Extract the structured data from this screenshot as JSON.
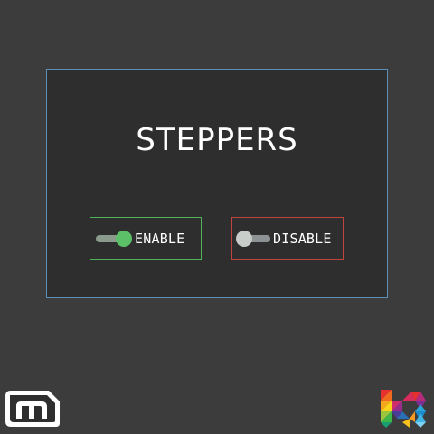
{
  "screen": {
    "title": "STEPPERS"
  },
  "toggles": [
    {
      "label": "ENABLE",
      "state": "on",
      "border_color": "#4fb35a",
      "knob_color": "#5cc068"
    },
    {
      "label": "DISABLE",
      "state": "off",
      "border_color": "#c0443d",
      "knob_color": "#c9cdc9"
    }
  ],
  "colors": {
    "background": "#3c3c3c",
    "panel_background": "#2e2e2e",
    "panel_border": "#5b8fb5"
  },
  "logos": {
    "left": "m-logo-icon",
    "right": "colorful-k-logo-icon"
  }
}
